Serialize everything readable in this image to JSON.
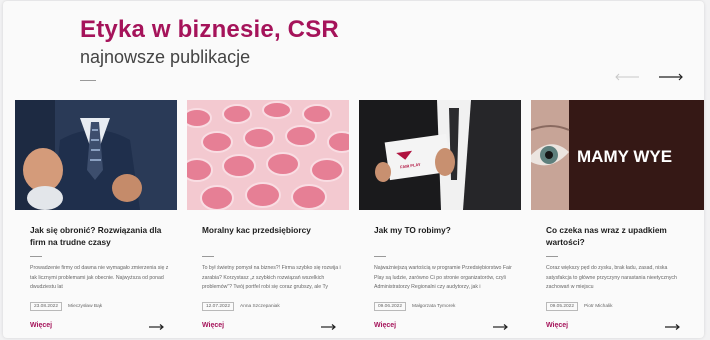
{
  "header": {
    "title": "Etyka w biznesie, CSR",
    "subtitle": "najnowsze publikacje"
  },
  "navigation": {
    "prev_icon": "arrow-left-icon",
    "next_icon": "arrow-right-icon"
  },
  "colors": {
    "accent": "#a5135a",
    "text": "#1d1d1d",
    "muted": "#666666"
  },
  "cards": [
    {
      "title": "Jak się obronić? Rozwiązania dla firm na trudne czasy",
      "excerpt": "Prowadzenie firmy od dawna nie wymagało zmierzenia się z tak licznymi problemami jak obecnie. Najwyższa od ponad dwudziestu lat",
      "date": "23.08.2022",
      "author": "Mieczysław Bąk",
      "more": "Więcej"
    },
    {
      "title": "Moralny kac przedsiębiorcy",
      "excerpt": "To był świetny pomysł na biznes?! Firma szybko się rozwija i zarabia? Korzystasz „z szybkich rozwiązań wszelkich problemów”? Twój portfel robi się coraz grubszy, ale Ty",
      "date": "12.07.2022",
      "author": "Anna Szczepaniak",
      "more": "Więcej"
    },
    {
      "title": "Jak my TO robimy?",
      "excerpt": "Najważniejszą wartością w programie Przedsiębiorstwo Fair Play są ludzie, zarówno Ci po stronie organizatorów, czyli Administratorzy Regionalni czy audytorzy, jak i",
      "date": "09.06.2022",
      "author": "Małgorzata Tymorek",
      "more": "Więcej",
      "card_text": "PRZEDSIĘBIORSTWO FAIR PLAY"
    },
    {
      "title": "Co czeka nas wraz z upadkiem wartości?",
      "excerpt": "Coraz większy pęd do zysku, brak ładu, zasad, niska satysfakcja to główne przyczyny narastania nieetycznych zachowań w miejscu",
      "date": "09.05.2022",
      "author": "Piotr Michalik",
      "more": "Więcej",
      "image_text": "MAMY WYE"
    }
  ]
}
